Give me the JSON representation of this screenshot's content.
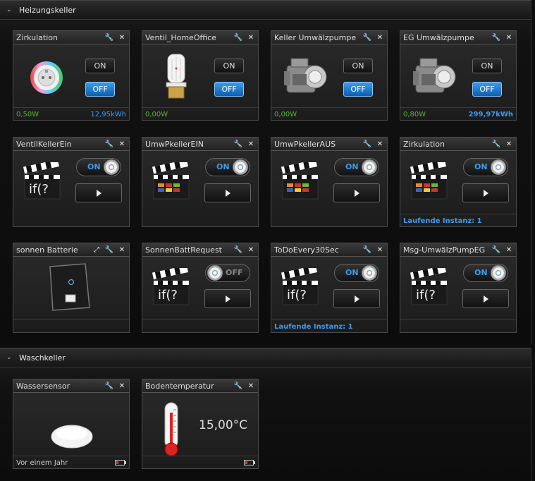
{
  "sections": {
    "heizung": {
      "title": "Heizungskeller"
    },
    "wasch": {
      "title": "Waschkeller"
    }
  },
  "tiles": {
    "zirk1": {
      "title": "Zirkulation",
      "on": "ON",
      "off": "OFF",
      "power": "0,50W",
      "energy": "12,95kWh"
    },
    "ventil": {
      "title": "Ventil_HomeOffice",
      "on": "ON",
      "off": "OFF",
      "power": "0,00W",
      "energy": ""
    },
    "kellerpump": {
      "title": "Keller Umwälzpumpe",
      "on": "ON",
      "off": "OFF",
      "power": "0,00W",
      "energy": ""
    },
    "egpump": {
      "title": "EG Umwälzpumpe",
      "on": "ON",
      "off": "OFF",
      "power": "0,80W",
      "energy": "299,97kWh"
    },
    "ventilkeller": {
      "title": "VentilKellerEin",
      "toggle": "ON",
      "script_text": "if(?"
    },
    "umwein": {
      "title": "UmwPkellerEIN",
      "toggle": "ON"
    },
    "umwaus": {
      "title": "UmwPkellerAUS",
      "toggle": "ON"
    },
    "zirk2": {
      "title": "Zirkulation",
      "toggle": "ON",
      "footer": "Laufende Instanz: 1"
    },
    "sonnen": {
      "title": "sonnen Batterie"
    },
    "sonnenreq": {
      "title": "SonnenBattRequest",
      "toggle": "OFF",
      "script_text": "if(?"
    },
    "todo": {
      "title": "ToDoEvery30Sec",
      "toggle": "ON",
      "script_text": "if(?",
      "footer": "Laufende Instanz: 1"
    },
    "msg": {
      "title": "Msg-UmwälzPumpEG",
      "toggle": "ON",
      "script_text": "if(?"
    },
    "wasser": {
      "title": "Wassersensor",
      "footer": "Vor einem Jahr"
    },
    "boden": {
      "title": "Bodentemperatur",
      "value": "15,00°C"
    }
  },
  "icons": {
    "wrench": "wrench-icon",
    "close": "close-icon",
    "expand": "expand-icon",
    "chevron": "chevron-down-icon"
  },
  "colors": {
    "accent": "#3b9cf0",
    "power_green": "#59b036"
  }
}
